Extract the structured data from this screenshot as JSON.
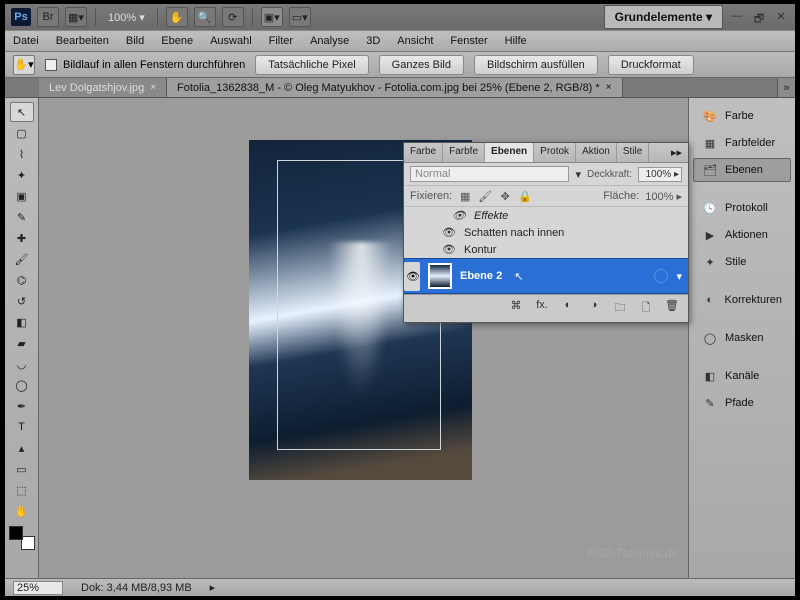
{
  "titlebar": {
    "zoom_pct": "100% ▾",
    "workspace_label": "Grundelemente ▾"
  },
  "menu": {
    "items": [
      "Datei",
      "Bearbeiten",
      "Bild",
      "Ebene",
      "Auswahl",
      "Filter",
      "Analyse",
      "3D",
      "Ansicht",
      "Fenster",
      "Hilfe"
    ]
  },
  "options": {
    "scroll_all_label": "Bildlauf in allen Fenstern durchführen",
    "actual_px": "Tatsächliche Pixel",
    "fit_screen": "Ganzes Bild",
    "fill_screen": "Bildschirm ausfüllen",
    "print_size": "Druckformat"
  },
  "tabs": {
    "t0": {
      "label": "Lev Dolgatshjov.jpg",
      "close": "×"
    },
    "t1": {
      "label": "Fotolia_1362838_M - © Oleg Matyukhov - Fotolia.com.jpg bei 25% (Ebene 2, RGB/8) *",
      "close": "×"
    },
    "nav": "»"
  },
  "right": {
    "farbe": "Farbe",
    "farbfelder": "Farbfelder",
    "ebenen": "Ebenen",
    "protokoll": "Protokoll",
    "aktionen": "Aktionen",
    "stile": "Stile",
    "korrekturen": "Korrekturen",
    "masken": "Masken",
    "kanaele": "Kanäle",
    "pfade": "Pfade"
  },
  "panel": {
    "tabs": {
      "farbe": "Farbe",
      "farbfe": "Farbfe",
      "ebenen": "Ebenen",
      "protok": "Protok",
      "aktion": "Aktion",
      "stile": "Stile",
      "nav": "▸▸"
    },
    "blend_mode": "Normal",
    "opacity_label": "Deckkraft:",
    "opacity_value": "100% ▸",
    "lock_label": "Fixieren:",
    "fill_label": "Fläche:",
    "fill_value": "100% ▸",
    "effects_header": "Effekte",
    "fx_inner_shadow": "Schatten nach innen",
    "fx_stroke": "Kontur",
    "layer_name": "Ebene 2",
    "foot": {
      "link": "⌘",
      "fx": "fx.",
      "mask": "◐",
      "adj": "◑",
      "group": "🗀",
      "new": "🗋",
      "trash": "🗑"
    }
  },
  "status": {
    "zoom": "25%",
    "doc": "Dok: 3,44 MB/8,93 MB",
    "scroll": "▸"
  },
  "watermark": "PSD-Tutorials.de"
}
